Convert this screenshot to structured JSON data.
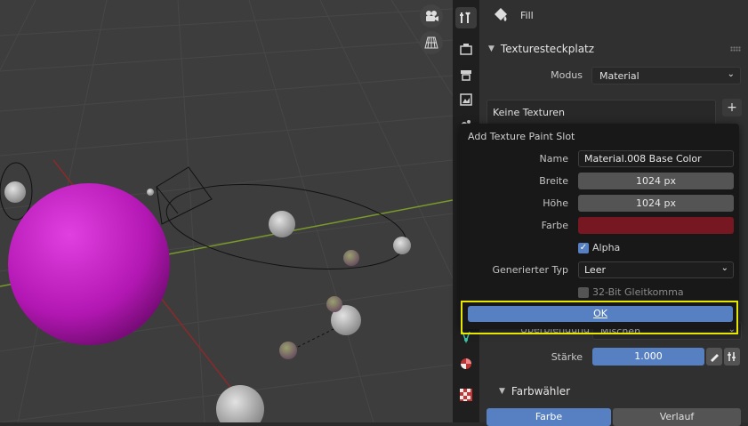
{
  "viewport": {
    "gizmo_icons": [
      "camera-view-icon",
      "grid-view-icon"
    ],
    "sphere_color": "#c21ec2"
  },
  "properties": {
    "header_label": "Fill",
    "texture_slot": {
      "title": "Texturesteckplatz",
      "mode_label": "Modus",
      "mode_value": "Material",
      "list_empty": "Keine Texturen"
    },
    "blend_label": "Überblendung",
    "blend_value": "Mischen",
    "strength_label": "Stärke",
    "strength_value": "1.000",
    "color_picker": {
      "title": "Farbwähler",
      "tabs": [
        "Farbe",
        "Verlauf"
      ]
    }
  },
  "dialog": {
    "title": "Add Texture Paint Slot",
    "name_label": "Name",
    "name_value": "Material.008 Base Color",
    "width_label": "Breite",
    "width_value": "1024 px",
    "height_label": "Höhe",
    "height_value": "1024 px",
    "color_label": "Farbe",
    "color_value": "#761722",
    "alpha_label": "Alpha",
    "alpha_checked": true,
    "gen_type_label": "Generierter Typ",
    "gen_type_value": "Leer",
    "float_label": "32-Bit Gleitkomma",
    "float_checked": false,
    "ok_label": "OK"
  }
}
